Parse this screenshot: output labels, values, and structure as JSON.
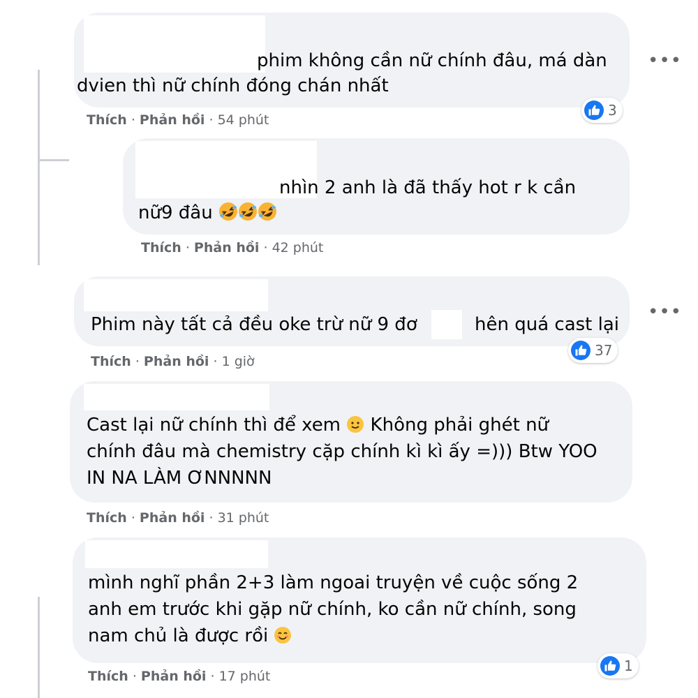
{
  "colors": {
    "bubble": "#f0f2f5",
    "like_blue": "#1877f2",
    "meta_gray": "#65676b"
  },
  "like_label": "Thích",
  "reply_label": "Phản hồi",
  "more_label": "•••",
  "comments": [
    {
      "lines": [
        "phim không cần nữ chính đâu, má dàn",
        "dvien thì nữ chính đóng chán nhất"
      ],
      "time": "54 phút",
      "reactions": "3"
    },
    {
      "lines": [
        "nhìn 2 anh là đã thấy hot r k cần",
        "nữ9 đâu"
      ],
      "emojis": [
        "rolling-on-floor-laughing-emoji",
        "rolling-on-floor-laughing-emoji",
        "rolling-on-floor-laughing-emoji"
      ],
      "time": "42 phút"
    },
    {
      "lines": [
        "Phim này tất cả đều oke trừ nữ 9 đơ",
        "hên quá cast lại"
      ],
      "time": "1 giờ",
      "reactions": "37"
    },
    {
      "lines": [
        "Cast lại nữ chính thì để xem",
        "Không phải ghét nữ",
        "chính đâu mà chemistry cặp chính kì kì ấy =))) Btw YOO",
        "IN NA LÀM ƠNNNNN"
      ],
      "emojis": [
        "slightly-smiling-emoji"
      ],
      "time": "31 phút"
    },
    {
      "lines": [
        "mình nghĩ phần 2+3 làm ngoai truyện về cuộc sống 2",
        "anh em trước khi gặp nữ chính, ko cần nữ chính, song",
        "nam chủ là được rồi"
      ],
      "emojis": [
        "smiling-face-emoji"
      ],
      "time": "17 phút",
      "reactions": "1"
    }
  ]
}
